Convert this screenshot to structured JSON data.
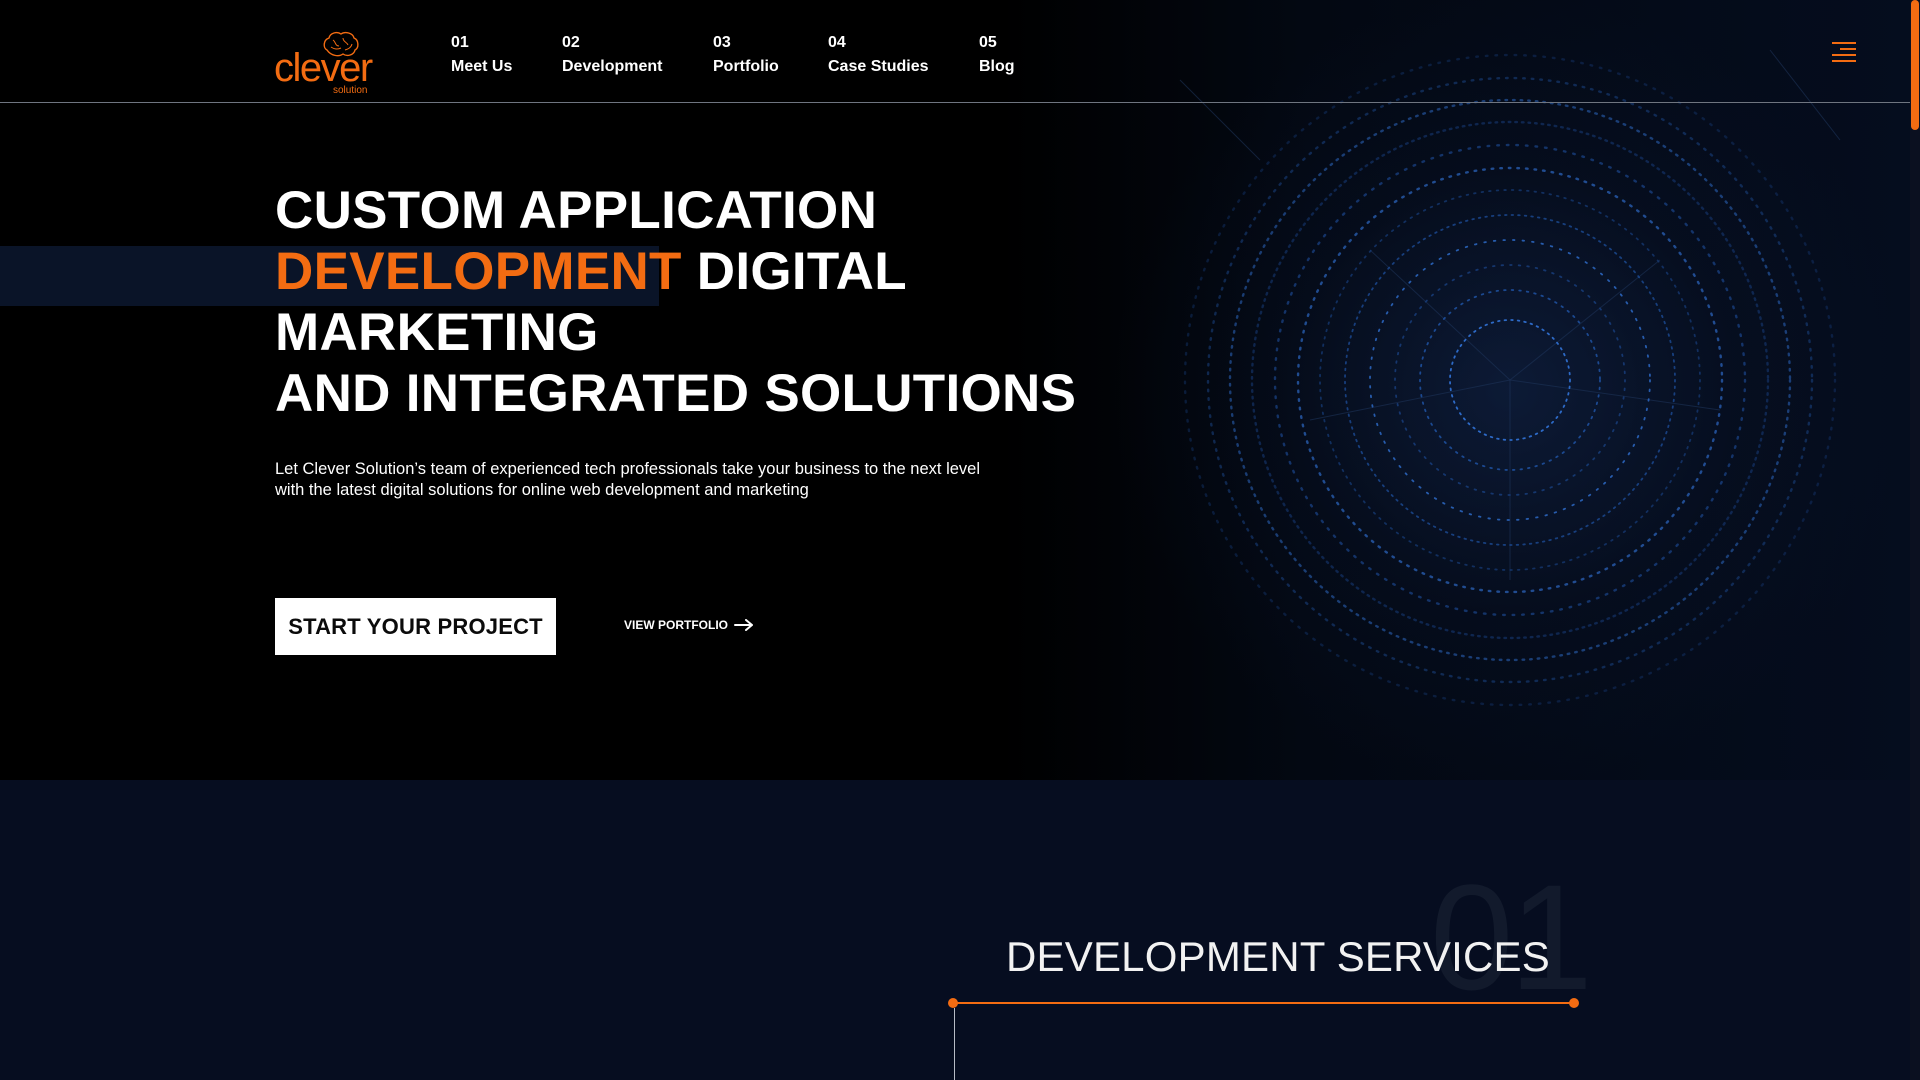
{
  "header": {
    "logo_text": "clever",
    "logo_sub": "solution",
    "nav": [
      {
        "num": "01",
        "label": "Meet Us"
      },
      {
        "num": "02",
        "label": "Development"
      },
      {
        "num": "03",
        "label": "Portfolio"
      },
      {
        "num": "04",
        "label": "Case Studies"
      },
      {
        "num": "05",
        "label": "Blog"
      }
    ],
    "menu_icon": "hamburger-menu-icon"
  },
  "hero": {
    "headline_line1": "CUSTOM APPLICATION",
    "headline_highlight": "DEVELOPMENT",
    "headline_line2_rest": "DIGITAL",
    "headline_line3": "MARKETING",
    "headline_line4": "AND INTEGRATED SOLUTIONS",
    "lead": "Let Clever Solution’s team of experienced tech professionals take your business to the next level with the latest digital solutions for online web development and marketing",
    "cta_primary": "START YOUR PROJECT",
    "cta_secondary": "VIEW PORTFOLIO",
    "cta_secondary_icon": "arrow-right-icon"
  },
  "services": {
    "watermark_number": "01",
    "title": "DEVELOPMENT SERVICES"
  },
  "colors": {
    "accent": "#f36c12",
    "background": "#000000",
    "section_bg": "#060d20",
    "text": "#ffffff"
  }
}
